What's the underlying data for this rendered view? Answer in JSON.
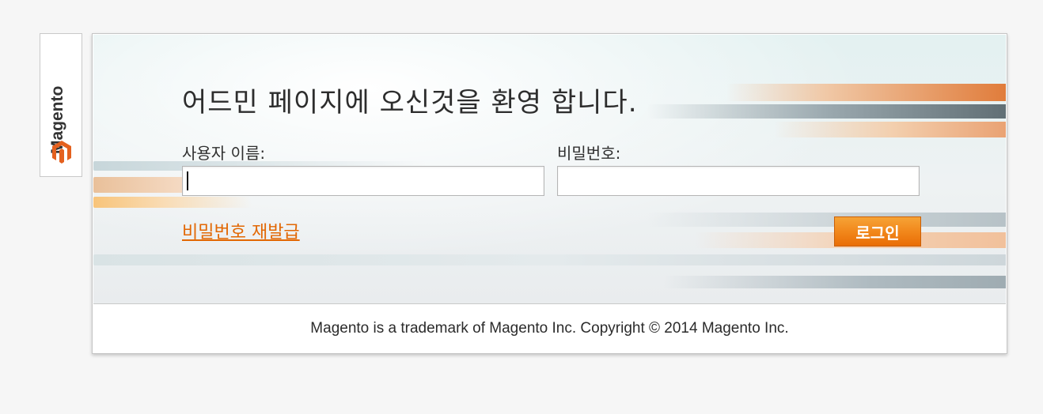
{
  "brand": {
    "name": "Magento",
    "accent": "#e4611f"
  },
  "login": {
    "welcome": "어드민 페이지에 오신것을 환영 합니다.",
    "username_label": "사용자 이름:",
    "username_value": "",
    "password_label": "비밀번호:",
    "password_value": "",
    "forgot_link": "비밀번호 재발급",
    "login_button": "로그인",
    "link_color": "#e26703",
    "button_color": "#f18519"
  },
  "footer": {
    "text": "Magento is a trademark of Magento Inc. Copyright © 2014 Magento Inc."
  }
}
